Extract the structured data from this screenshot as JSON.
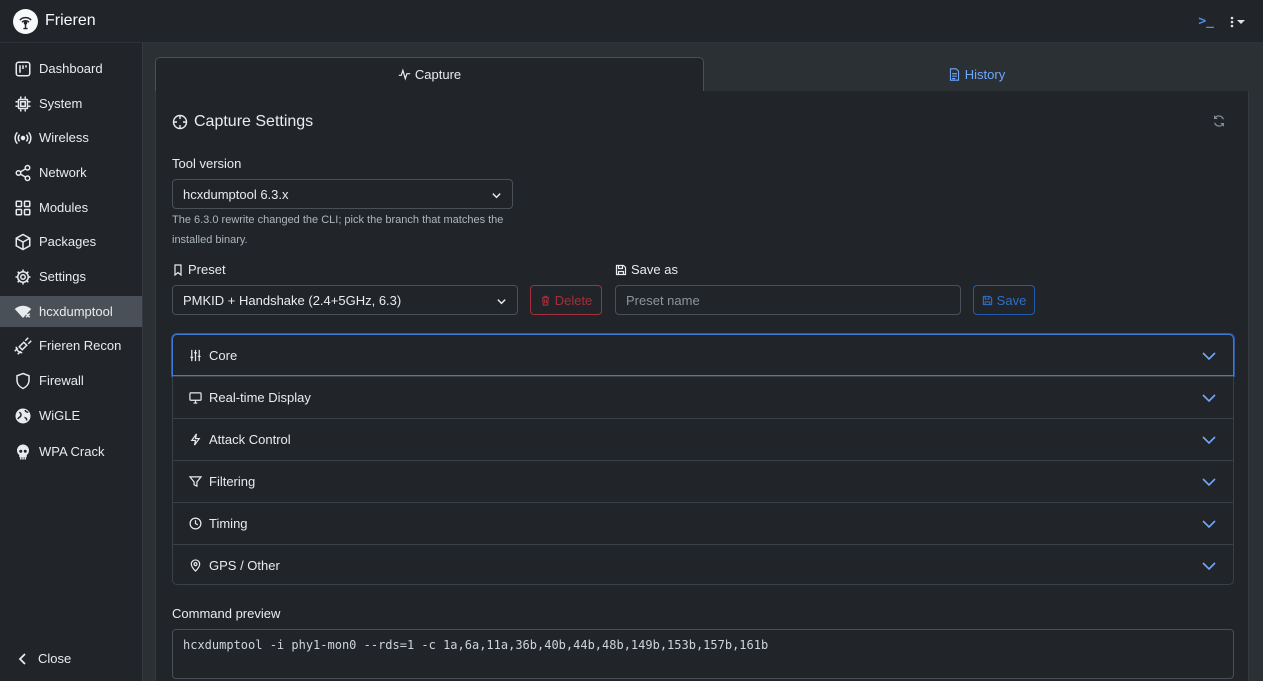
{
  "app": {
    "title": "Frieren",
    "logo_icon": "wifi-antenna-icon",
    "accent": "#4d8fe6"
  },
  "top_actions": {
    "terminal_icon": ">_",
    "menu_icon": "kebab-menu-icon"
  },
  "sidebar": {
    "items": [
      {
        "label": "Dashboard",
        "icon": "dashboard-icon"
      },
      {
        "label": "System",
        "icon": "cpu-icon"
      },
      {
        "label": "Wireless",
        "icon": "broadcast-icon"
      },
      {
        "label": "Network",
        "icon": "share-nodes-icon"
      },
      {
        "label": "Modules",
        "icon": "grid-icon"
      },
      {
        "label": "Packages",
        "icon": "box-icon"
      },
      {
        "label": "Settings",
        "icon": "gear-icon"
      },
      {
        "label": "hcxdumptool",
        "icon": "wifi-off-icon",
        "active": true
      },
      {
        "label": "Frieren Recon",
        "icon": "satellite-icon"
      },
      {
        "label": "Firewall",
        "icon": "shield-icon"
      },
      {
        "label": "WiGLE",
        "icon": "globe-icon"
      },
      {
        "label": "WPA Crack",
        "icon": "skull-icon"
      }
    ],
    "close_label": "Close"
  },
  "tabs": {
    "capture": "Capture",
    "history": "History"
  },
  "panel": {
    "title": "Capture Settings",
    "tool_version": {
      "label": "Tool version",
      "value": "hcxdumptool 6.3.x",
      "help": "The 6.3.0 rewrite changed the CLI; pick the branch that matches the installed binary."
    },
    "preset": {
      "label": "Preset",
      "value": "PMKID + Handshake (2.4+5GHz, 6.3)",
      "delete_label": "Delete"
    },
    "save_as": {
      "label": "Save as",
      "placeholder": "Preset name",
      "save_label": "Save"
    },
    "sections": [
      {
        "label": "Core",
        "icon": "sliders-icon"
      },
      {
        "label": "Real-time Display",
        "icon": "monitor-icon"
      },
      {
        "label": "Attack Control",
        "icon": "lightning-icon"
      },
      {
        "label": "Filtering",
        "icon": "filter-icon"
      },
      {
        "label": "Timing",
        "icon": "clock-icon"
      },
      {
        "label": "GPS / Other",
        "icon": "location-pin-icon"
      }
    ],
    "command_preview": {
      "label": "Command preview",
      "value": "hcxdumptool -i phy1-mon0 --rds=1 -c 1a,6a,11a,36b,40b,44b,48b,149b,153b,157b,161b"
    }
  }
}
